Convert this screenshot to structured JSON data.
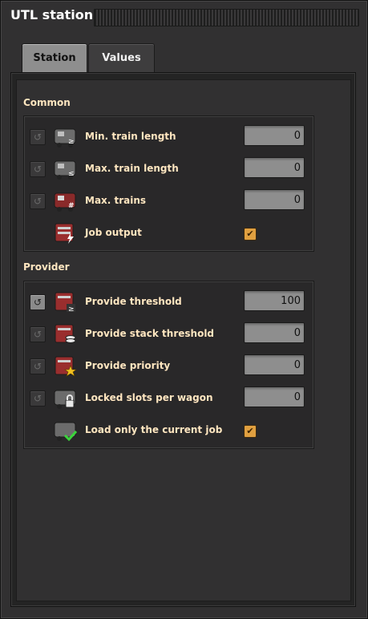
{
  "window": {
    "title": "UTL station"
  },
  "tabs": [
    {
      "label": "Station",
      "selected": true
    },
    {
      "label": "Values",
      "selected": false
    }
  ],
  "sections": {
    "common": {
      "label": "Common",
      "rows": [
        {
          "label": "Min. train length",
          "value": "0",
          "icon": "train-min-length-icon"
        },
        {
          "label": "Max. train length",
          "value": "0",
          "icon": "train-max-length-icon"
        },
        {
          "label": "Max. trains",
          "value": "0",
          "icon": "train-count-icon"
        },
        {
          "label": "Job output",
          "checked": true,
          "icon": "job-output-icon"
        }
      ]
    },
    "provider": {
      "label": "Provider",
      "rows": [
        {
          "label": "Provide threshold",
          "value": "100",
          "icon": "provide-threshold-icon"
        },
        {
          "label": "Provide stack threshold",
          "value": "0",
          "icon": "stack-threshold-icon"
        },
        {
          "label": "Provide priority",
          "value": "0",
          "icon": "priority-star-icon"
        },
        {
          "label": "Locked slots per wagon",
          "value": "0",
          "icon": "lock-icon"
        },
        {
          "label": "Load only the current job",
          "checked": true,
          "icon": "checkmark-wagon-icon"
        }
      ]
    }
  },
  "glyphs": {
    "reset": "↺",
    "check": "✔"
  },
  "colors": {
    "label": "#ffe6c0",
    "checkbox": "#e0a040",
    "panel": "#313031"
  }
}
